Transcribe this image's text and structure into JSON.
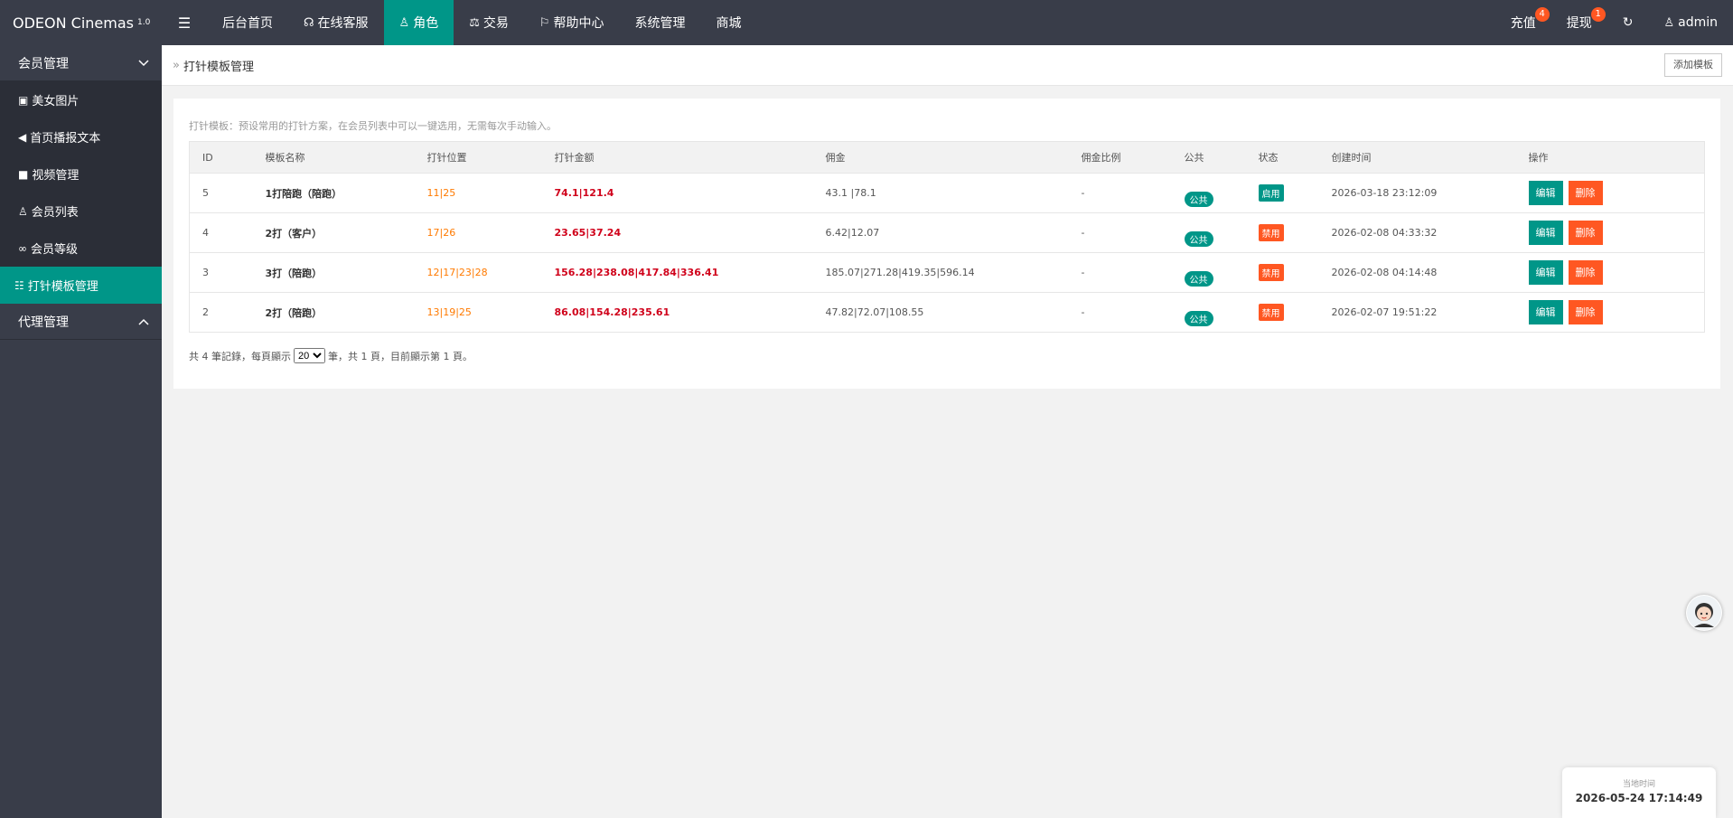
{
  "header": {
    "logo": "ODEON Cinemas",
    "logo_version": "1.0",
    "nav": [
      "后台首页",
      "在线客服",
      "角色",
      "交易",
      "帮助中心",
      "系统管理",
      "商城"
    ],
    "recharge": "充值",
    "recharge_badge": "4",
    "withdraw": "提现",
    "withdraw_badge": "1",
    "user": "admin"
  },
  "sidebar": {
    "group1": "会员管理",
    "items": [
      "美女图片",
      "首页播报文本",
      "视频管理",
      "会员列表",
      "会员等级",
      "打针模板管理"
    ],
    "group2": "代理管理"
  },
  "page": {
    "title": "打针模板管理",
    "add_button": "添加模板",
    "hint": "打针模板：预设常用的打针方案，在会员列表中可以一键选用，无需每次手动输入。"
  },
  "table": {
    "headers": [
      "ID",
      "模板名称",
      "打针位置",
      "打针金额",
      "佣金",
      "佣金比例",
      "公共",
      "状态",
      "创建时间",
      "操作"
    ],
    "rows": [
      {
        "id": "5",
        "name": "1打陪跑（陪跑）",
        "pos": "11|25",
        "amount": "74.1|121.4",
        "commission": "43.1 |78.1",
        "ratio": "-",
        "public": "公共",
        "status": "启用",
        "created": "2026-03-18 23:12:09"
      },
      {
        "id": "4",
        "name": "2打（客户）",
        "pos": "17|26",
        "amount": "23.65|37.24",
        "commission": "6.42|12.07",
        "ratio": "-",
        "public": "公共",
        "status": "禁用",
        "created": "2026-02-08 04:33:32"
      },
      {
        "id": "3",
        "name": "3打（陪跑）",
        "pos": "12|17|23|28",
        "amount": "156.28|238.08|417.84|336.41",
        "commission": "185.07|271.28|419.35|596.14",
        "ratio": "-",
        "public": "公共",
        "status": "禁用",
        "created": "2026-02-08 04:14:48"
      },
      {
        "id": "2",
        "name": "2打（陪跑）",
        "pos": "13|19|25",
        "amount": "86.08|154.28|235.61",
        "commission": "47.82|72.07|108.55",
        "ratio": "-",
        "public": "公共",
        "status": "禁用",
        "created": "2026-02-07 19:51:22"
      }
    ],
    "edit_label": "编辑",
    "delete_label": "删除"
  },
  "pager": {
    "prefix": "共 4 筆記錄，每頁顯示",
    "page_size": "20",
    "suffix": "筆，共 1 頁，目前顯示第 1 頁。"
  },
  "clock": {
    "label": "当地时间",
    "time": "2026-05-24 17:14:49"
  },
  "colors": {
    "header_bg": "#393d49",
    "accent": "#009688",
    "danger": "#ff5722"
  }
}
